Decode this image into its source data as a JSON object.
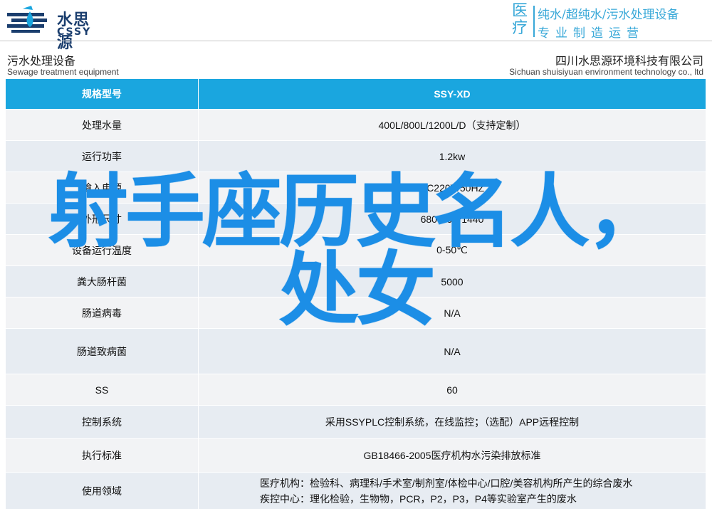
{
  "header": {
    "logo_cn": "水思源",
    "logo_en": "CSSY",
    "tagline_big": "医疗",
    "tagline_line1": "纯水/超纯水/污水处理设备",
    "tagline_line2": "专业制造运营"
  },
  "subtitle": {
    "left_cn": "污水处理设备",
    "left_en": "Sewage treatment equipment",
    "right_cn": "四川水思源环境科技有限公司",
    "right_en": "Sichuan shuisiyuan environment technology co., ltd"
  },
  "table": {
    "header": {
      "key": "规格型号",
      "value": "SSY-XD"
    },
    "rows": [
      {
        "key": "处理水量",
        "value": "400L/800L/1200L/D（支持定制）"
      },
      {
        "key": "运行功率",
        "value": "1.2kw"
      },
      {
        "key": "输入电源",
        "value": "AC220V/50HZ"
      },
      {
        "key": "外形尺寸",
        "value": "680*360*1440"
      },
      {
        "key": "设备运行温度",
        "value": "0-50℃"
      },
      {
        "key": "粪大肠杆菌",
        "value": "5000"
      },
      {
        "key": "肠道病毒",
        "value": "N/A"
      },
      {
        "key": "肠道致病菌",
        "value": "N/A"
      },
      {
        "key": "SS",
        "value": "60"
      },
      {
        "key": "控制系统",
        "value": "采用SSYPLC控制系统，在线监控；（选配）APP远程控制"
      },
      {
        "key": "执行标准",
        "value": "GB18466-2005医疗机构水污染排放标准"
      },
      {
        "key": "使用领域",
        "value_line1": "医疗机构：检验科、病理科/手术室/制剂室/体检中心/口腔/美容机构所产生的综合废水",
        "value_line2": "疾控中心：理化检验，生物物，PCR，P2，P3，P4等实验室产生的废水"
      }
    ]
  },
  "overlay": {
    "line1": "射手座历史名人，",
    "line2": "处女"
  },
  "colors": {
    "header_blue": "#1aa6df",
    "overlay_blue": "#1c8ee6",
    "brand_navy": "#1b3e6e",
    "tagline_blue": "#38a8d8"
  }
}
